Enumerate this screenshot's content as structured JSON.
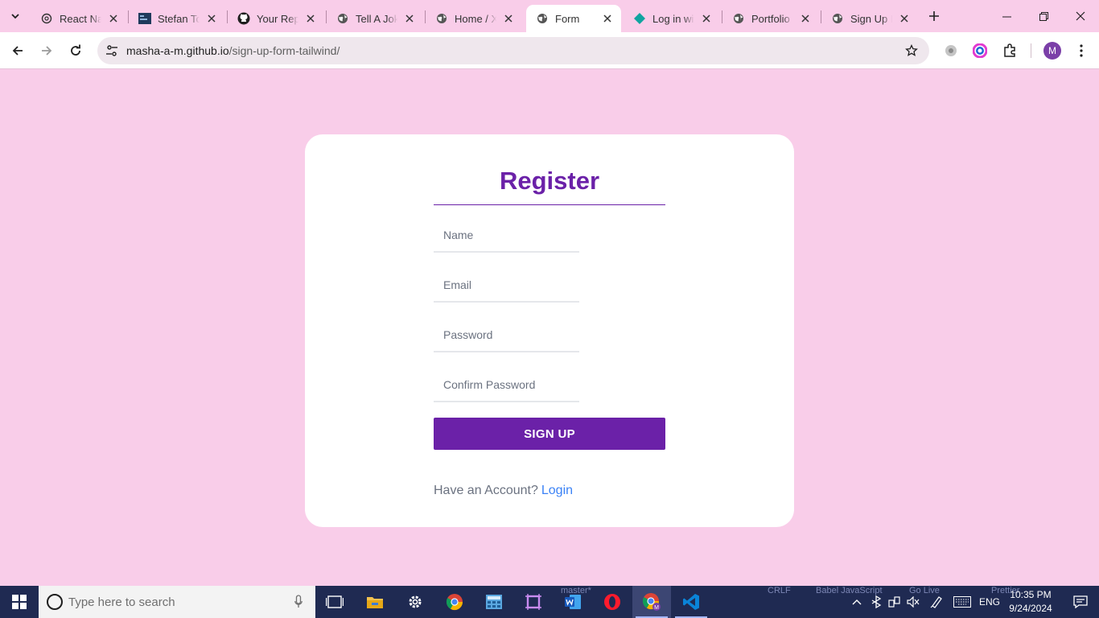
{
  "browser": {
    "tabs": [
      {
        "title": "React Nav",
        "icon": "openai-icon",
        "active": false
      },
      {
        "title": "Stefan Top",
        "icon": "terminal-icon",
        "active": false
      },
      {
        "title": "Your Repo",
        "icon": "github-icon",
        "active": false
      },
      {
        "title": "Tell A Joke",
        "icon": "globe-icon",
        "active": false
      },
      {
        "title": "Home / X",
        "icon": "globe-icon",
        "active": false
      },
      {
        "title": "Form",
        "icon": "globe-icon",
        "active": true
      },
      {
        "title": "Log in wit",
        "icon": "diamond-icon",
        "active": false
      },
      {
        "title": "Portfolio",
        "icon": "globe-icon",
        "active": false
      },
      {
        "title": "Sign Up P",
        "icon": "globe-icon",
        "active": false
      }
    ],
    "url_host": "masha-a-m.github.io",
    "url_path": "/sign-up-form-tailwind/",
    "profile_initial": "M"
  },
  "form": {
    "title": "Register",
    "fields": [
      {
        "placeholder": "Name",
        "type": "text"
      },
      {
        "placeholder": "Email",
        "type": "email"
      },
      {
        "placeholder": "Password",
        "type": "password"
      },
      {
        "placeholder": "Confirm Password",
        "type": "password"
      }
    ],
    "submit_label": "SIGN UP",
    "account_prompt": "Have an Account?",
    "login_link": "Login"
  },
  "taskbar": {
    "search_placeholder": "Type here to search",
    "apps": [
      "task-view",
      "file-explorer",
      "settings",
      "chrome",
      "calculator-app",
      "snipping-tool",
      "word",
      "opera",
      "chrome-profile",
      "vscode"
    ],
    "language": "ENG",
    "time": "10:35 PM",
    "date": "9/24/2024",
    "background_status": [
      "master*",
      "CRLF",
      "Babel JavaScript",
      "Go Live",
      "Prettier"
    ]
  },
  "colors": {
    "page_background": "#f9cde9",
    "accent": "#6b21a8",
    "link": "#3b82f6"
  }
}
